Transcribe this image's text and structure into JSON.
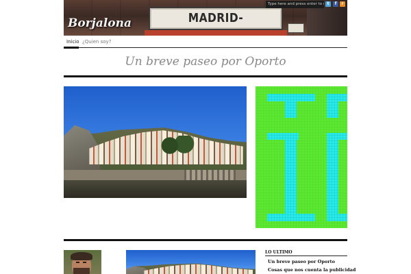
{
  "site": {
    "title": "Borjalona",
    "header_sign": "MADRID-BARCELONA",
    "search_placeholder": "Type here and press enter to search"
  },
  "social": {
    "twitter": "t",
    "facebook": "f",
    "rss": "r"
  },
  "nav": {
    "items": [
      {
        "label": "Inicio",
        "active": true
      },
      {
        "label": "¿Quien soy?",
        "active": false
      }
    ]
  },
  "post": {
    "title": "Un breve paseo por Oporto"
  },
  "sidebar": {
    "heading": "LO ULTIMO",
    "recent": [
      "Un breve paseo por Oporto",
      "Cosas que nos cuenta la publicidad"
    ]
  },
  "colors": {
    "graphic_green": "#55e02a",
    "graphic_cyan": "#22e6e6"
  }
}
